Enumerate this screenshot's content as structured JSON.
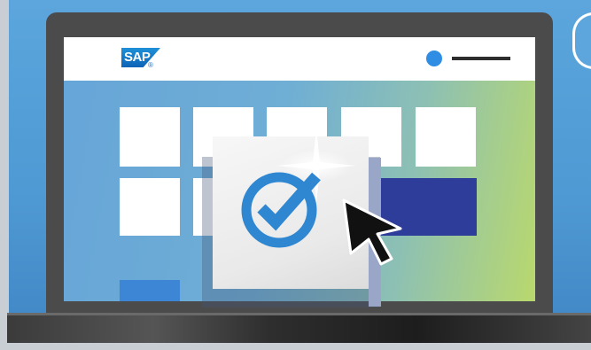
{
  "brand": {
    "logo_text": "SAP",
    "logo_mark": "®"
  },
  "header": {
    "user_icon": "user-avatar-dot",
    "menu_icon": "menu-line-icon"
  },
  "content": {
    "tile_rows": 2,
    "highlight_icon": "check-circle-icon",
    "pointer_icon": "mouse-cursor-icon"
  },
  "colors": {
    "background": "#5ca6dd",
    "laptop": "#4b4b4b",
    "accent": "#2f8de4",
    "highlight_tile": "#2f3d9a",
    "screen_green": "#b9d86d"
  }
}
